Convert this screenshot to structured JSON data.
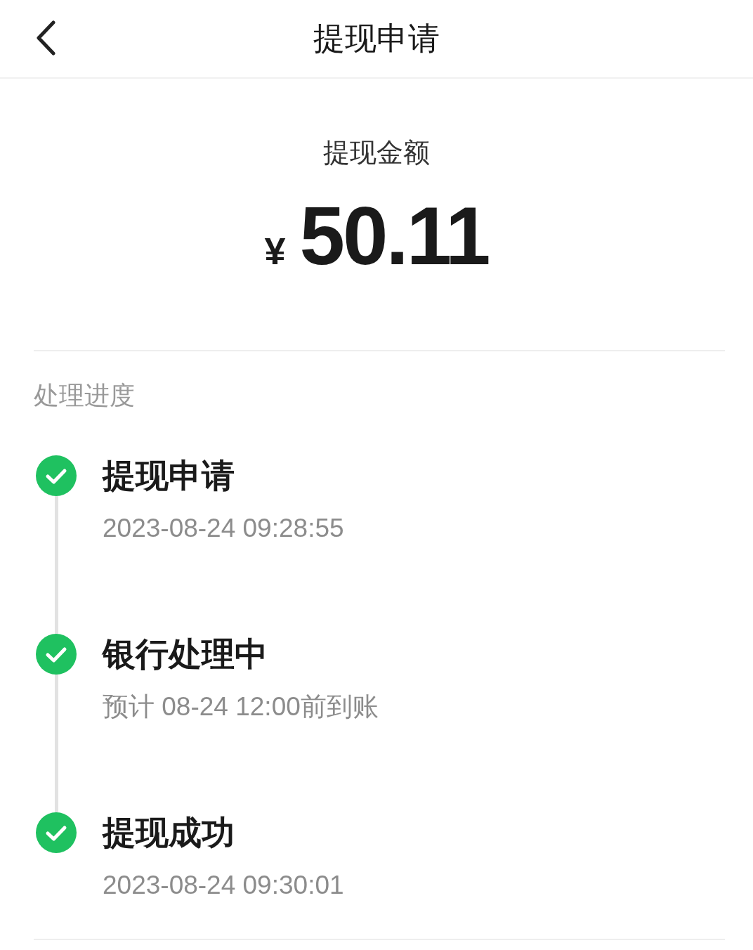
{
  "header": {
    "title": "提现申请"
  },
  "amount": {
    "label": "提现金额",
    "currency": "¥",
    "value": "50.11"
  },
  "progress": {
    "title": "处理进度",
    "steps": [
      {
        "title": "提现申请",
        "detail": "2023-08-24 09:28:55",
        "done": true
      },
      {
        "title": "银行处理中",
        "detail": "预计 08-24 12:00前到账",
        "done": true
      },
      {
        "title": "提现成功",
        "detail": "2023-08-24 09:30:01",
        "done": true
      }
    ]
  }
}
